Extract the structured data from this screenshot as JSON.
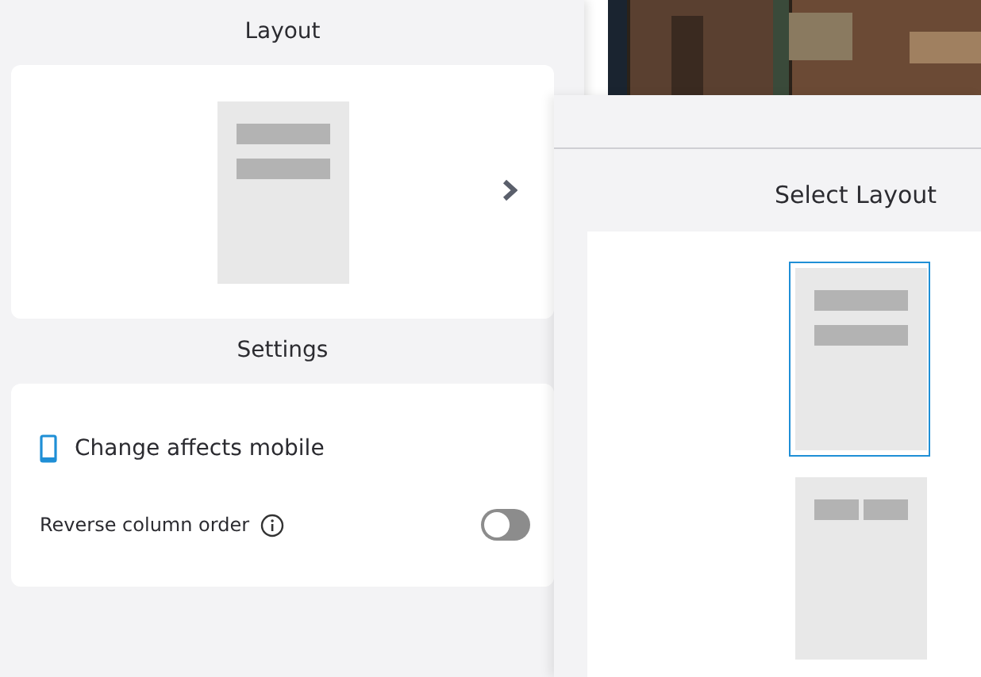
{
  "layout_section": {
    "title": "Layout",
    "current": {
      "kind": "stacked"
    }
  },
  "settings_section": {
    "title": "Settings",
    "mobile_note": "Change affects mobile",
    "reverse_column_order": {
      "label": "Reverse column order",
      "on": false
    }
  },
  "layout_picker": {
    "title": "Select Layout",
    "options": [
      {
        "kind": "stacked",
        "selected": true
      },
      {
        "kind": "side-by-side",
        "selected": false
      }
    ]
  }
}
